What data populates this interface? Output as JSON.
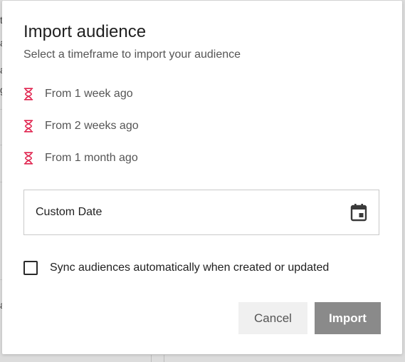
{
  "dialog": {
    "title": "Import audience",
    "subtitle": "Select a timeframe to import your audience",
    "options": [
      {
        "label": "From 1 week ago",
        "icon": "hourglass-icon"
      },
      {
        "label": "From 2 weeks ago",
        "icon": "hourglass-icon"
      },
      {
        "label": "From 1 month ago",
        "icon": "hourglass-icon"
      }
    ],
    "custom_date": {
      "label": "Custom Date",
      "icon": "calendar-icon"
    },
    "sync": {
      "label": "Sync audiences automatically when created or updated",
      "checked": false
    },
    "buttons": {
      "cancel": "Cancel",
      "import": "Import"
    }
  },
  "colors": {
    "accent_icon": "#e0234e",
    "import_button_disabled": "#8a8a8a",
    "cancel_button_bg": "#f0f0f0"
  }
}
